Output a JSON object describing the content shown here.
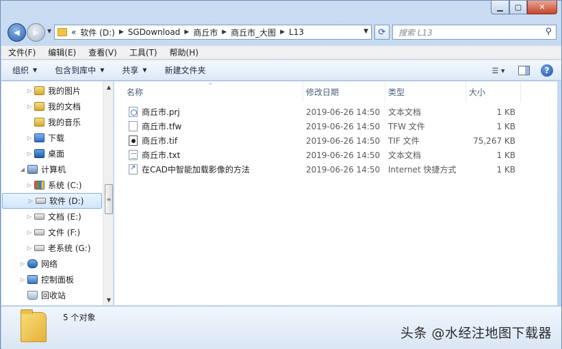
{
  "window": {
    "min": "▁",
    "max": "▢",
    "close": "✕"
  },
  "nav": {
    "back_icon": "◀",
    "forward_icon": "▶",
    "dropdown": "▼"
  },
  "address": {
    "prefix": "«",
    "crumbs": [
      "软件 (D:)",
      "SGDownload",
      "商丘市",
      "商丘市_大图",
      "L13"
    ],
    "separator": "▶",
    "dropdown": "▼"
  },
  "refresh_icon": "⟳",
  "search": {
    "placeholder": "搜索 L13",
    "icon": "⚲"
  },
  "menu": [
    "文件(F)",
    "编辑(E)",
    "查看(V)",
    "工具(T)",
    "帮助(H)"
  ],
  "commands": {
    "organize": "组织",
    "include_in_library": "包含到库中",
    "share": "共享",
    "new_folder": "新建文件夹",
    "dropdown": "▼",
    "view_icon": "☰ ▾",
    "help": "?"
  },
  "tree": [
    {
      "label": "我的图片",
      "icon": "library",
      "expander": "▷",
      "level": 2
    },
    {
      "label": "我的文档",
      "icon": "library",
      "expander": "▷",
      "level": 2
    },
    {
      "label": "我的音乐",
      "icon": "library",
      "expander": "",
      "level": 2
    },
    {
      "label": "下载",
      "icon": "downloads",
      "expander": "▷",
      "level": 2
    },
    {
      "label": "桌面",
      "icon": "desktop",
      "expander": "▷",
      "level": 2
    },
    {
      "label": "计算机",
      "icon": "computer",
      "expander": "◢",
      "level": 1
    },
    {
      "label": "系统 (C:)",
      "icon": "system-drive",
      "expander": "▷",
      "level": 2
    },
    {
      "label": "软件 (D:)",
      "icon": "drive",
      "expander": "▷",
      "level": 2,
      "selected": true
    },
    {
      "label": "文档 (E:)",
      "icon": "drive",
      "expander": "▷",
      "level": 2
    },
    {
      "label": "文件 (F:)",
      "icon": "drive",
      "expander": "▷",
      "level": 2
    },
    {
      "label": "老系统 (G:)",
      "icon": "drive",
      "expander": "▷",
      "level": 2
    },
    {
      "label": "网络",
      "icon": "network",
      "expander": "▷",
      "level": 1
    },
    {
      "label": "控制面板",
      "icon": "control-panel",
      "expander": "▷",
      "level": 1
    },
    {
      "label": "回收站",
      "icon": "recycle-bin",
      "expander": "",
      "level": 1
    }
  ],
  "scroll": {
    "up": "▲",
    "down": "▼",
    "grip": "≡"
  },
  "columns": {
    "name": "名称",
    "date": "修改日期",
    "type": "类型",
    "size": "大小",
    "sort_indicator": "^"
  },
  "files": [
    {
      "name": "商丘市.prj",
      "date": "2019-06-26 14:50",
      "type": "文本文档",
      "size": "1 KB",
      "icon": "prj"
    },
    {
      "name": "商丘市.tfw",
      "date": "2019-06-26 14:50",
      "type": "TFW 文件",
      "size": "1 KB",
      "icon": "blank"
    },
    {
      "name": "商丘市.tif",
      "date": "2019-06-26 14:50",
      "type": "TIF 文件",
      "size": "75,267 KB",
      "icon": "tif"
    },
    {
      "name": "商丘市.txt",
      "date": "2019-06-26 14:50",
      "type": "文本文档",
      "size": "1 KB",
      "icon": "txt"
    },
    {
      "name": "在CAD中智能加载影像的方法",
      "date": "2019-06-26 14:50",
      "type": "Internet 快捷方式",
      "size": "1 KB",
      "icon": "url"
    }
  ],
  "status": {
    "count": "5 个对象"
  },
  "watermark": "头条 @水经注地图下载器"
}
